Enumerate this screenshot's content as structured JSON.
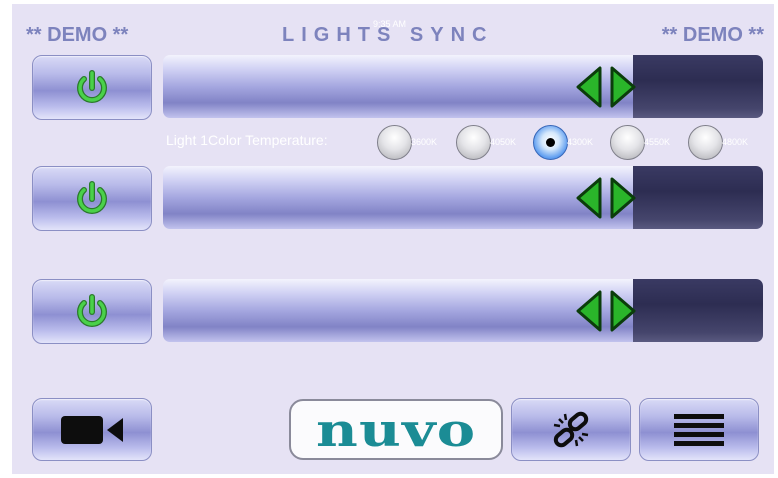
{
  "header": {
    "demo_left": "** DEMO **",
    "title": "LIGHTS SYNC",
    "clock": "9:35 AM",
    "demo_right": "** DEMO **"
  },
  "lights": [
    {
      "icon": "power-icon"
    },
    {
      "icon": "power-icon"
    },
    {
      "icon": "power-icon"
    }
  ],
  "color_temperature": {
    "label": "Light 1Color Temperature:",
    "options": [
      "3600K",
      "4050K",
      "4300K",
      "4550K",
      "4800K"
    ],
    "selected": "4300K"
  },
  "bottom_bar": {
    "camera_icon": "video-camera-icon",
    "logo_text": "nuvo",
    "link_icon": "broken-link-icon",
    "menu_icon": "menu-icon"
  },
  "colors": {
    "background": "#e6e2f4",
    "header_text": "#7d83bd",
    "power_green": "#3cc63c",
    "arrow_green": "#2ab52a",
    "logo_teal": "#1b8c95"
  }
}
